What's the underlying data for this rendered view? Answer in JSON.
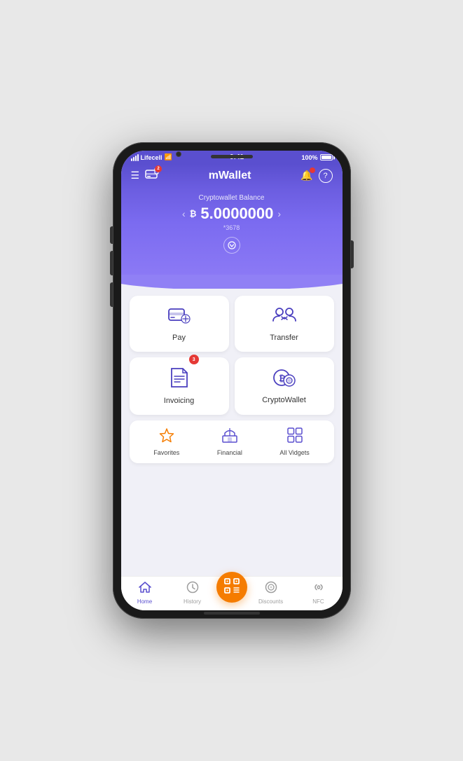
{
  "status": {
    "carrier": "Lifecell",
    "time": "9:41",
    "battery": "100%"
  },
  "header": {
    "title": "mWallet",
    "card_badge": "2"
  },
  "balance": {
    "label": "Cryptowallet Balance",
    "currency": "₿",
    "amount": "5.0000000",
    "account": "*3678",
    "chevron": "⌄"
  },
  "services": [
    {
      "id": "pay",
      "label": "Pay",
      "icon": "pay",
      "badge": null
    },
    {
      "id": "transfer",
      "label": "Transfer",
      "icon": "transfer",
      "badge": null
    },
    {
      "id": "invoicing",
      "label": "Invoicing",
      "icon": "invoice",
      "badge": "3"
    },
    {
      "id": "cryptowallet",
      "label": "CryptoWallet",
      "icon": "crypto",
      "badge": null
    }
  ],
  "widgets": [
    {
      "id": "favorites",
      "label": "Favorites",
      "icon": "★",
      "color": "orange"
    },
    {
      "id": "financial",
      "label": "Financial",
      "icon": "⛪",
      "color": "purple"
    },
    {
      "id": "allvidgets",
      "label": "All Vidgets",
      "icon": "⊞",
      "color": "purple"
    }
  ],
  "nav": [
    {
      "id": "home",
      "label": "Home",
      "icon": "⌂",
      "active": true
    },
    {
      "id": "history",
      "label": "History",
      "icon": "🕐",
      "active": false
    },
    {
      "id": "scan",
      "label": "",
      "icon": "⊡",
      "active": false,
      "special": true
    },
    {
      "id": "discounts",
      "label": "Discounts",
      "icon": "◎",
      "active": false
    },
    {
      "id": "nfc",
      "label": "NFC",
      "icon": "((•))",
      "active": false
    }
  ]
}
